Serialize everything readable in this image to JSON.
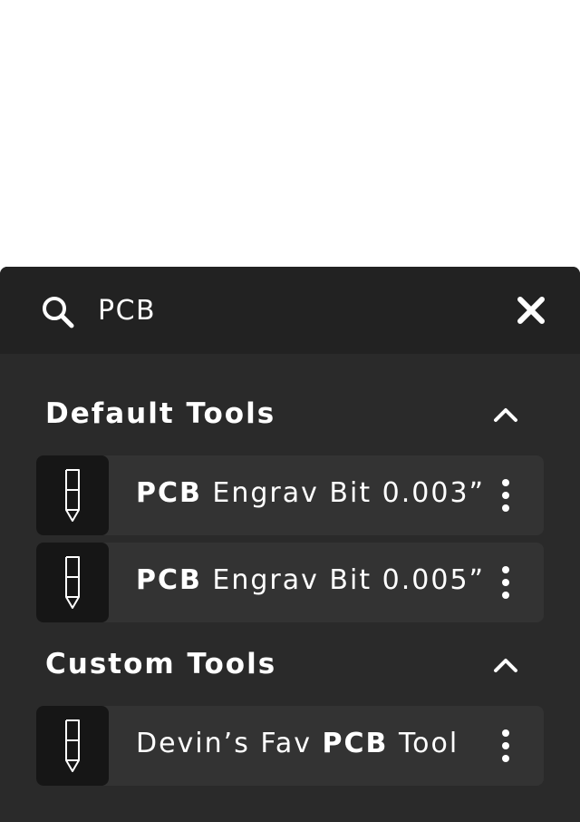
{
  "search": {
    "value": "PCB",
    "icon": "search-icon",
    "clear_icon": "close-icon"
  },
  "sections": [
    {
      "title": "Default Tools",
      "toggle_icon": "chevron-up-icon",
      "items": [
        {
          "bold": "PCB",
          "rest": " Engrav Bit 0.003”",
          "icon": "engraving-bit-icon",
          "menu_icon": "more-vertical-icon"
        },
        {
          "bold": "PCB",
          "rest": " Engrav Bit 0.005”",
          "icon": "engraving-bit-icon",
          "menu_icon": "more-vertical-icon"
        }
      ]
    },
    {
      "title": "Custom Tools",
      "toggle_icon": "chevron-up-icon",
      "items": [
        {
          "pre": "Devin’s Fav ",
          "bold": "PCB",
          "rest": " Tool",
          "icon": "engraving-bit-icon",
          "menu_icon": "more-vertical-icon"
        }
      ]
    }
  ],
  "colors": {
    "panel_bg": "#2a2a2a",
    "search_bg": "#222222",
    "row_bg": "#333333",
    "thumb_bg": "#161616",
    "text": "#ffffff"
  }
}
